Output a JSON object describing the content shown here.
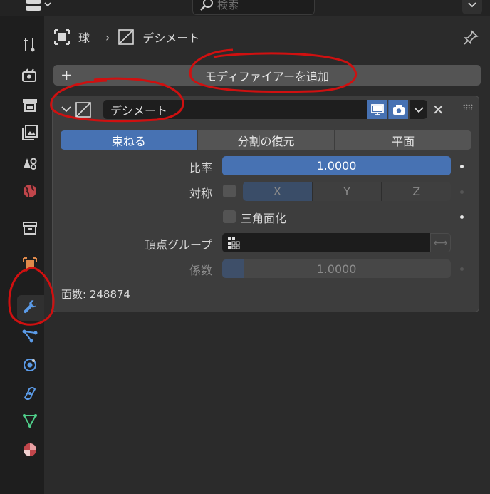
{
  "header": {
    "search_placeholder": "検索",
    "breadcrumb_object": "球",
    "breadcrumb_separator": "›",
    "breadcrumb_modifier": "デシメート"
  },
  "sidebar": {
    "tabs": [
      "tool",
      "render",
      "output",
      "view-layer",
      "scene",
      "world",
      "collection",
      "object",
      "modifiers",
      "particles",
      "physics",
      "constraints",
      "data",
      "material"
    ],
    "active": "modifiers"
  },
  "modifier": {
    "add_label": "モディファイアーを追加",
    "add_symbol": "+",
    "name": "デシメート",
    "close": "✕",
    "modes": [
      "束ねる",
      "分割の復元",
      "平面"
    ],
    "active_mode": "束ねる",
    "ratio_label": "比率",
    "ratio_value": "1.0000",
    "symmetry_label": "対称",
    "axes": [
      "X",
      "Y",
      "Z"
    ],
    "triangulate_label": "三角面化",
    "vertex_group_label": "頂点グループ",
    "swap_symbol": "⟷",
    "factor_label": "係数",
    "factor_value": "1.0000",
    "face_count": "面数: 248874"
  },
  "colors": {
    "accent": "#4772b3",
    "annotation": "#d01010"
  }
}
